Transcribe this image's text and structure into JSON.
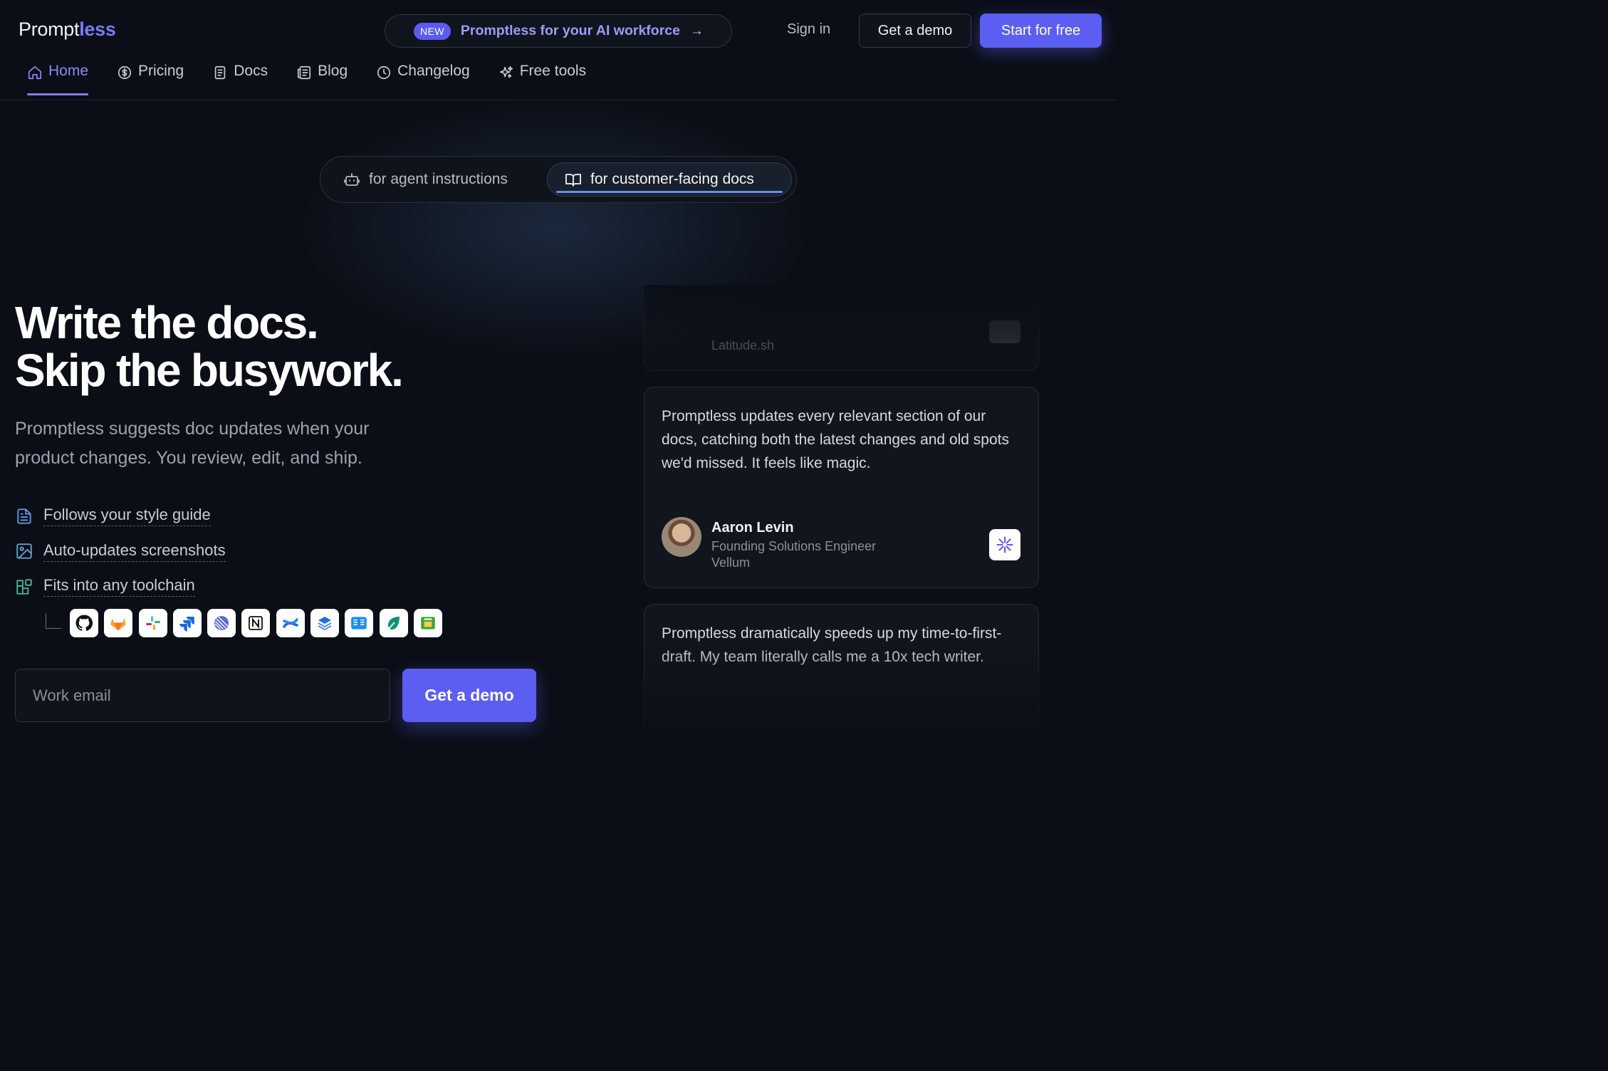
{
  "brand": {
    "logo_main": "Prompt",
    "logo_accent": "less",
    "accent_color": "#5b5ef0"
  },
  "announcement": {
    "badge": "NEW",
    "text": "Promptless for your AI workforce",
    "arrow": "→"
  },
  "header": {
    "sign_in": "Sign in",
    "get_demo": "Get a demo",
    "start_free": "Start for free"
  },
  "nav": {
    "items": [
      {
        "label": "Home",
        "icon": "home-icon",
        "active": true
      },
      {
        "label": "Pricing",
        "icon": "dollar-icon"
      },
      {
        "label": "Docs",
        "icon": "document-icon"
      },
      {
        "label": "Blog",
        "icon": "newspaper-icon"
      },
      {
        "label": "Changelog",
        "icon": "clock-icon"
      },
      {
        "label": "Free tools",
        "icon": "sparkles-icon"
      }
    ]
  },
  "segment": {
    "options": [
      {
        "label": "for agent instructions",
        "icon": "robot-icon",
        "selected": false
      },
      {
        "label": "for customer-facing docs",
        "icon": "book-icon",
        "selected": true
      }
    ]
  },
  "hero": {
    "headline_line1": "Write the docs.",
    "headline_line2": "Skip the busywork.",
    "subhead": "Promptless suggests doc updates when your product changes. You review, edit, and ship.",
    "features": [
      {
        "label": "Follows your style guide",
        "icon": "file-text-icon"
      },
      {
        "label": "Auto-updates screenshots",
        "icon": "image-icon"
      },
      {
        "label": "Fits into any toolchain",
        "icon": "blocks-icon"
      }
    ],
    "integrations": [
      "github-icon",
      "gitlab-icon",
      "slack-icon",
      "jira-icon",
      "linear-icon",
      "notion-icon",
      "confluence-icon",
      "readme-icon",
      "gitbook-icon",
      "mintlify-icon",
      "zendesk-icon"
    ],
    "email_placeholder": "Work email",
    "cta": "Get a demo"
  },
  "testimonials": {
    "top": {
      "company": "Latitude.sh"
    },
    "middle": {
      "quote": "Promptless updates every relevant section of our docs, catching both the latest changes and old spots we'd missed. It feels like magic.",
      "name": "Aaron Levin",
      "role": "Founding Solutions Engineer",
      "company": "Vellum"
    },
    "bottom": {
      "quote": "Promptless dramatically speeds up my time-to-first-draft. My team literally calls me a 10x tech writer."
    }
  }
}
